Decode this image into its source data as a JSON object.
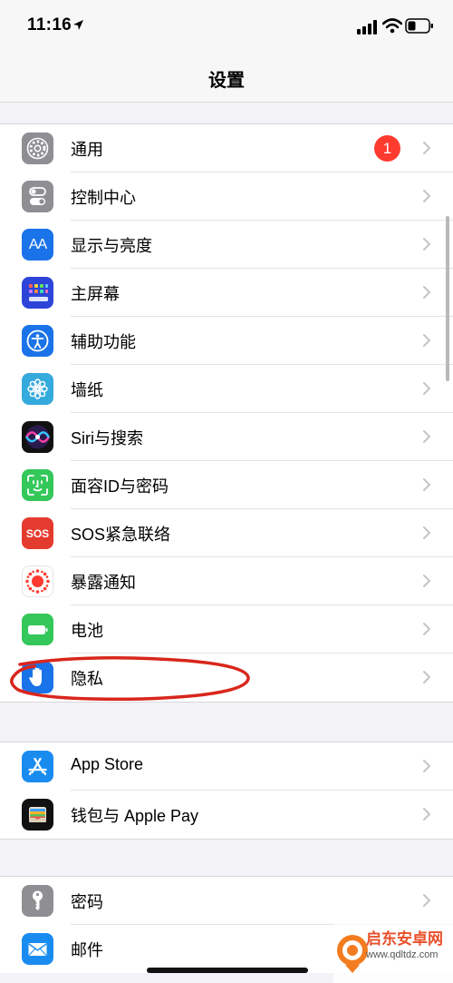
{
  "status_bar": {
    "time": "11:16"
  },
  "navigation": {
    "title": "设置"
  },
  "groups": [
    {
      "items": [
        {
          "label": "通用",
          "icon": "gear-icon",
          "badge": "1"
        },
        {
          "label": "控制中心",
          "icon": "switches-icon"
        },
        {
          "label": "显示与亮度",
          "icon": "text-size-icon",
          "icon_text": "AA"
        },
        {
          "label": "主屏幕",
          "icon": "home-grid-icon"
        },
        {
          "label": "辅助功能",
          "icon": "accessibility-icon"
        },
        {
          "label": "墙纸",
          "icon": "flower-icon"
        },
        {
          "label": "Siri与搜索",
          "icon": "siri-icon"
        },
        {
          "label": "面容ID与密码",
          "icon": "face-id-icon"
        },
        {
          "label": "SOS紧急联络",
          "icon": "sos-icon",
          "icon_text": "SOS"
        },
        {
          "label": "暴露通知",
          "icon": "exposure-icon"
        },
        {
          "label": "电池",
          "icon": "battery-icon"
        },
        {
          "label": "隐私",
          "icon": "hand-icon"
        }
      ]
    },
    {
      "items": [
        {
          "label": "App Store",
          "icon": "app-store-icon"
        },
        {
          "label": "钱包与 Apple Pay",
          "icon": "wallet-icon"
        }
      ]
    },
    {
      "items": [
        {
          "label": "密码",
          "icon": "key-icon"
        },
        {
          "label": "邮件",
          "icon": "mail-icon"
        }
      ]
    }
  ],
  "watermark": {
    "line1": "启东安卓网",
    "line2": "www.qdltdz.com"
  },
  "colors": {
    "badge": "#ff3b30",
    "annotation": "#d9261c",
    "general_icon": "#8e8e93",
    "display_icon": "#1a73e8",
    "home_icon": "#2c45d8",
    "wallpaper_icon": "#35aadc",
    "face_id_icon": "#34c759",
    "sos_icon": "#e33b2e",
    "battery_icon": "#34c759",
    "privacy_icon": "#1a73e8"
  }
}
